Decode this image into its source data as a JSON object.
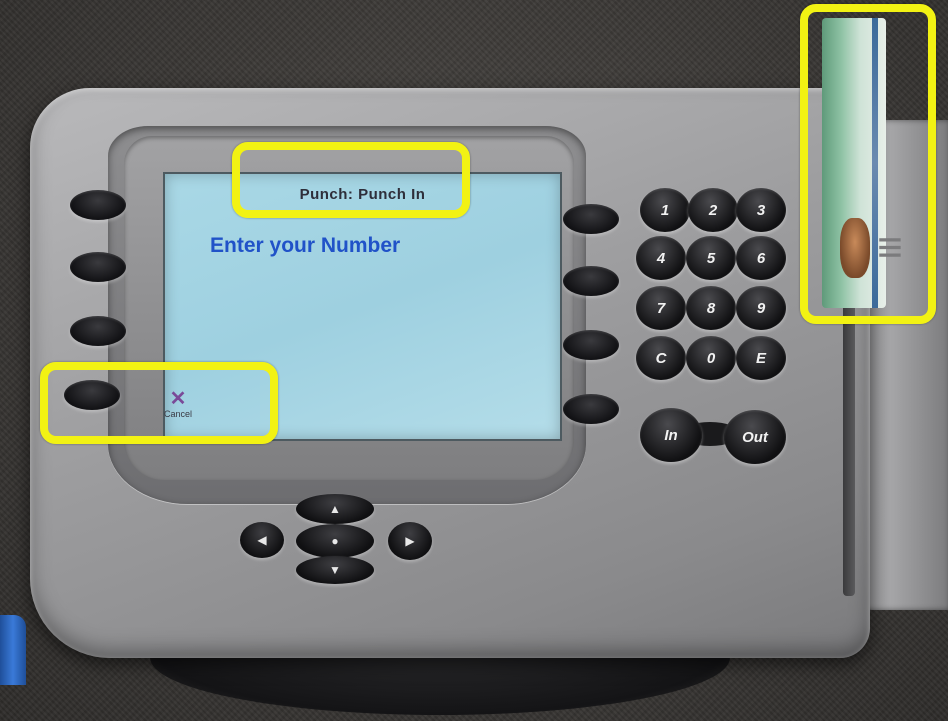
{
  "screen": {
    "title": "Punch: Punch In",
    "prompt": "Enter your Number",
    "cancel": {
      "icon": "x-icon",
      "label": "Cancel"
    }
  },
  "keypad": {
    "keys": [
      "1",
      "2",
      "3",
      "4",
      "5",
      "6",
      "7",
      "8",
      "9",
      "C",
      "0",
      "E"
    ],
    "in_label": "In",
    "out_label": "Out"
  },
  "nav": {
    "up_icon": "▲",
    "down_icon": "▼",
    "left_icon": "◀",
    "right_icon": "▶",
    "center_icon": "●"
  },
  "colors": {
    "highlight": "#f2f213",
    "screen_bg": "#a9d8e6",
    "prompt_text": "#2052c8",
    "device_body": "#9d9d9f"
  }
}
